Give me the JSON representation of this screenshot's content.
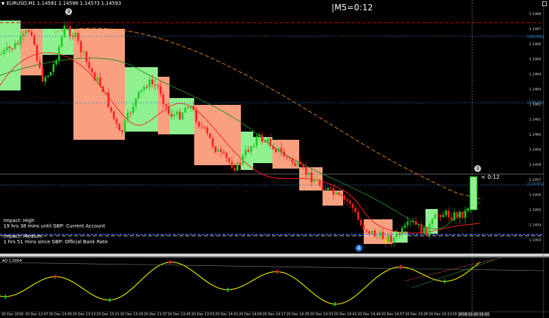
{
  "symbol_header": "EURUSD,M1  1.14581 1.14596 1.14573 1.14593",
  "timer_text": "|M5=0:12",
  "last_countdown": "< 0:12",
  "marker_top": "3",
  "marker_bottom": "4",
  "marker_last": "3",
  "news": [
    {
      "text": "Impact: High",
      "color": "#ff2020"
    },
    {
      "text": "19 hrs 38 mins until GBP: Current Account",
      "color": "#3aa0ff"
    },
    {
      "text": "Impact: Medium",
      "color": "#f0a020"
    },
    {
      "text": "1 hrs 51 mins since GBP: Official Bank Rate",
      "color": "#3aa0ff"
    }
  ],
  "fib_labels": [
    "[161.8%]",
    "[138.2%]",
    "[123.6%]"
  ],
  "price_labels": [
    "1.1468",
    "1.1467",
    "1.1466",
    "1.1465",
    "1.1464",
    "1.1463",
    "1.1462",
    "1.1461",
    "1.1460",
    "1.1459",
    "1.1458",
    "1.1457",
    "1.1456",
    "1.1455",
    "1.1454",
    "1.1453"
  ],
  "ao_label": "AO 1.0004",
  "time_labels": [
    "20 Dec 2018",
    "20 Dec 12:57",
    "20 Dec 13:05",
    "20 Dec 13:13",
    "20 Dec 13:21",
    "20 Dec 13:29",
    "20 Dec 13:37",
    "20 Dec 13:45",
    "20 Dec 13:53",
    "20 Dec 14:01",
    "20 Dec 14:09",
    "20 Dec 14:17",
    "20 Dec 14:25",
    "20 Dec 14:33",
    "20 Dec 14:41",
    "20 Dec 14:49",
    "20 Dec 14:57",
    "20 Dec 15:05",
    "20 Dec 15:13",
    "20 Dec 15:21"
  ],
  "time_highlight": "2018.12.20 15:32",
  "colors": {
    "up_box": "#90f090",
    "down_box": "#f8a080",
    "up_candle": "#22cc22",
    "down_candle": "#ff2020",
    "ma_slow": "#e08020",
    "ma_mid": "#2a8a2a",
    "ma_fast": "#ff2020",
    "ao_line": "#e8e800"
  }
}
